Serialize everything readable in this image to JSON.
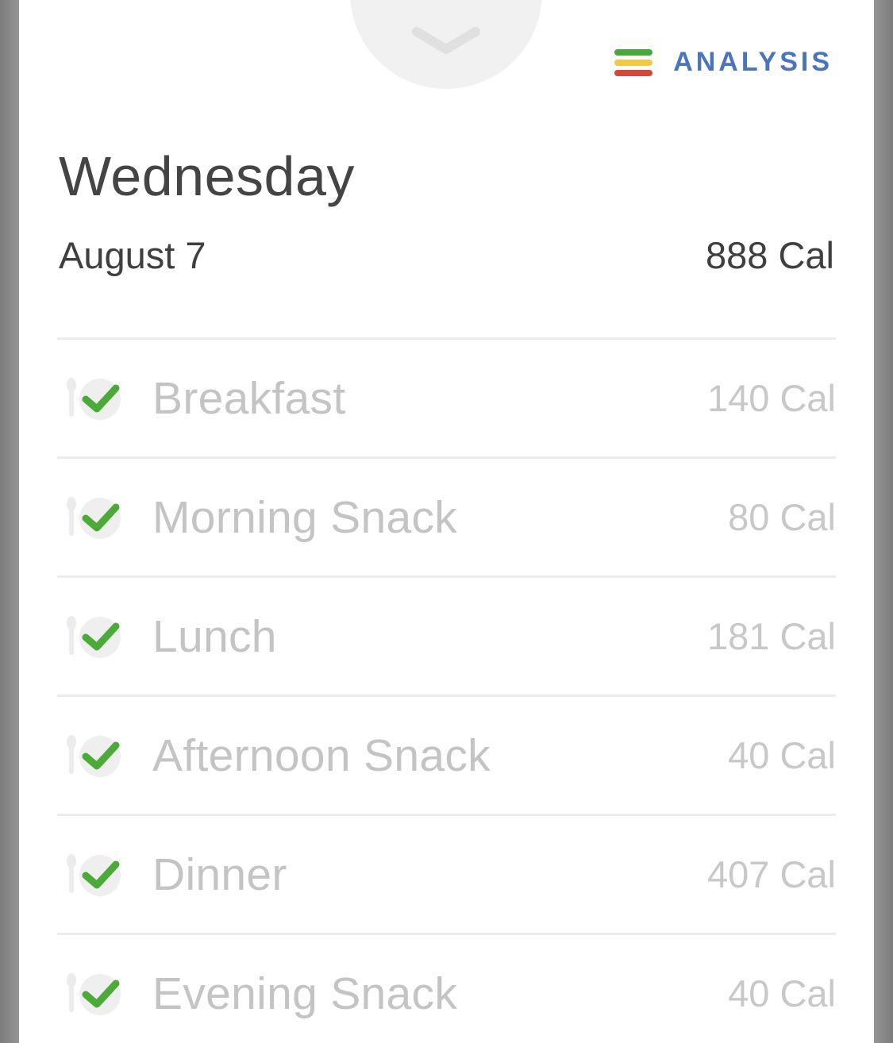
{
  "header": {
    "analysis_label": "ANALYSIS",
    "analysis_color": "#4a73c0",
    "analysis_icon_colors": [
      "#48a83c",
      "#f3c843",
      "#d5473b"
    ],
    "collapse_icon": "chevron-down-icon"
  },
  "day": {
    "title": "Wednesday",
    "date": "August 7",
    "total_calories": "888 Cal"
  },
  "meals": [
    {
      "name": "Breakfast",
      "calories": "140 Cal",
      "logged": true
    },
    {
      "name": "Morning Snack",
      "calories": "80 Cal",
      "logged": true
    },
    {
      "name": "Lunch",
      "calories": "181 Cal",
      "logged": true
    },
    {
      "name": "Afternoon Snack",
      "calories": "40 Cal",
      "logged": true
    },
    {
      "name": "Dinner",
      "calories": "407 Cal",
      "logged": true
    },
    {
      "name": "Evening Snack",
      "calories": "40 Cal",
      "logged": true
    }
  ],
  "colors": {
    "check": "#4cab38",
    "meal_text": "#c4c4c4",
    "divider": "#ececec"
  }
}
